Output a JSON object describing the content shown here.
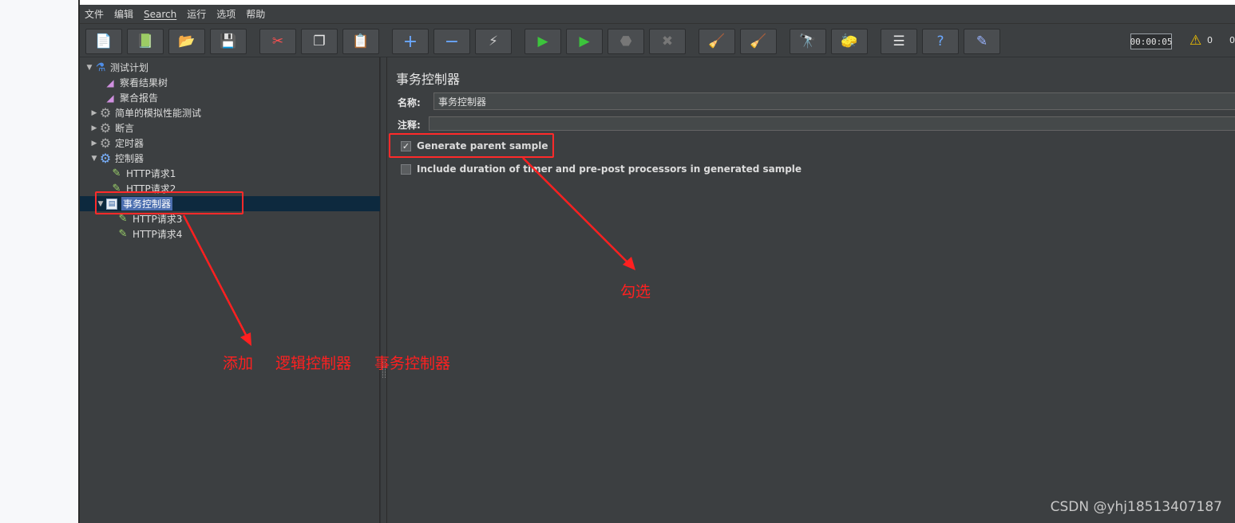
{
  "menu": [
    "文件",
    "编辑",
    "Search",
    "运行",
    "选项",
    "帮助"
  ],
  "toolbar": {
    "buttons": [
      {
        "name": "new-icon",
        "glyph": "📄"
      },
      {
        "name": "templates-icon",
        "glyph": "📗"
      },
      {
        "name": "open-icon",
        "glyph": "📂"
      },
      {
        "name": "save-icon",
        "glyph": "💾"
      },
      {
        "name": "cut-icon",
        "glyph": "✂"
      },
      {
        "name": "copy-icon",
        "glyph": "❐"
      },
      {
        "name": "paste-icon",
        "glyph": "📋"
      },
      {
        "name": "expand-icon",
        "glyph": "+"
      },
      {
        "name": "collapse-icon",
        "glyph": "−"
      },
      {
        "name": "toggle-icon",
        "glyph": "⚡"
      },
      {
        "name": "start-icon",
        "glyph": "▶"
      },
      {
        "name": "start-no-timers-icon",
        "glyph": "▶"
      },
      {
        "name": "stop-icon",
        "glyph": "⬣"
      },
      {
        "name": "shutdown-icon",
        "glyph": "✖"
      },
      {
        "name": "clear-icon",
        "glyph": "🧹"
      },
      {
        "name": "clear-all-icon",
        "glyph": "🧹"
      },
      {
        "name": "search-binoculars-icon",
        "glyph": "🔭"
      },
      {
        "name": "reset-search-icon",
        "glyph": "🧽"
      },
      {
        "name": "function-helper-icon",
        "glyph": "☰"
      },
      {
        "name": "help-icon",
        "glyph": "?"
      },
      {
        "name": "remote-icon",
        "glyph": "✎"
      }
    ],
    "timer": "00:00:05",
    "warning_count": "0",
    "extra_count": "0"
  },
  "tree": [
    {
      "label": "测试计划",
      "icon": "plan-icon",
      "twisty": "▼"
    },
    {
      "label": "察看结果树",
      "icon": "chart-icon",
      "twisty": ""
    },
    {
      "label": "聚合报告",
      "icon": "chart-icon",
      "twisty": ""
    },
    {
      "label": "简单的模拟性能测试",
      "icon": "gear-icon",
      "twisty": "▶"
    },
    {
      "label": "断言",
      "icon": "gear-icon",
      "twisty": "▶"
    },
    {
      "label": "定时器",
      "icon": "gear-icon",
      "twisty": "▶"
    },
    {
      "label": "控制器",
      "icon": "gear-icon",
      "twisty": "▼"
    },
    {
      "label": "HTTP请求1",
      "icon": "pipette-icon",
      "twisty": ""
    },
    {
      "label": "HTTP请求2",
      "icon": "pipette-icon",
      "twisty": ""
    },
    {
      "label": "事务控制器",
      "icon": "transaction-icon",
      "twisty": "▼"
    },
    {
      "label": "HTTP请求3",
      "icon": "pipette-icon",
      "twisty": ""
    },
    {
      "label": "HTTP请求4",
      "icon": "pipette-icon",
      "twisty": ""
    }
  ],
  "form": {
    "title": "事务控制器",
    "name_label": "名称:",
    "name_value": "事务控制器",
    "comment_label": "注释:",
    "comment_value": "",
    "cb1_label": "Generate parent sample",
    "cb1_checked": "✓",
    "cb2_label": "Include duration of timer and pre-post processors in generated sample"
  },
  "annotations": {
    "check_text": "勾选",
    "add_text_1": "添加",
    "add_text_2": "逻辑控制器",
    "add_text_3": "事务控制器",
    "color": "#ff2020"
  },
  "watermark": "CSDN @yhj18513407187"
}
